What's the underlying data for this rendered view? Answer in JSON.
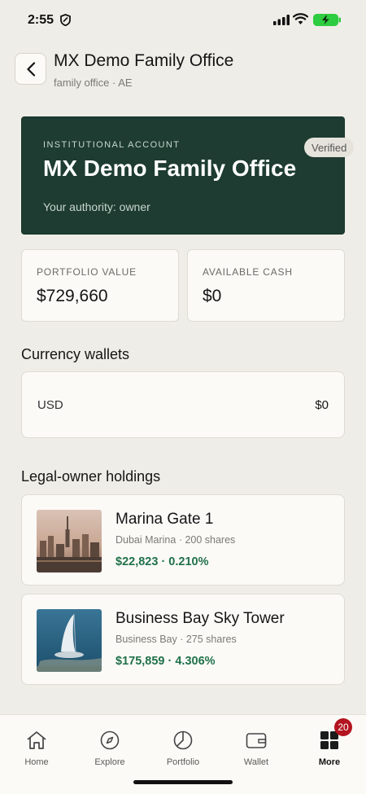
{
  "status_bar": {
    "time": "2:55"
  },
  "header": {
    "title": "MX Demo Family Office",
    "subtitle": "family office · AE"
  },
  "account_card": {
    "kicker": "INSTITUTIONAL ACCOUNT",
    "name": "MX Demo Family Office",
    "authority": "Your authority: owner",
    "badge": "Verified"
  },
  "stats": [
    {
      "label": "PORTFOLIO VALUE",
      "value": "$729,660"
    },
    {
      "label": "AVAILABLE CASH",
      "value": "$0"
    }
  ],
  "wallets": {
    "title": "Currency wallets",
    "items": [
      {
        "currency": "USD",
        "amount": "$0"
      }
    ]
  },
  "holdings": {
    "title": "Legal-owner holdings",
    "items": [
      {
        "name": "Marina Gate 1",
        "meta": "Dubai Marina · 200 shares",
        "value": "$22,823 · 0.210%"
      },
      {
        "name": "Business Bay Sky Tower",
        "meta": "Business Bay · 275 shares",
        "value": "$175,859 · 4.306%"
      }
    ]
  },
  "nav": {
    "items": [
      {
        "label": "Home",
        "icon": "home-icon"
      },
      {
        "label": "Explore",
        "icon": "compass-icon"
      },
      {
        "label": "Portfolio",
        "icon": "pie-chart-icon"
      },
      {
        "label": "Wallet",
        "icon": "wallet-icon"
      },
      {
        "label": "More",
        "icon": "grid-icon",
        "badge": "20",
        "active": true
      }
    ]
  },
  "colors": {
    "accent_dark": "#1e3c31",
    "positive": "#20714a",
    "badge": "#b3141f"
  }
}
